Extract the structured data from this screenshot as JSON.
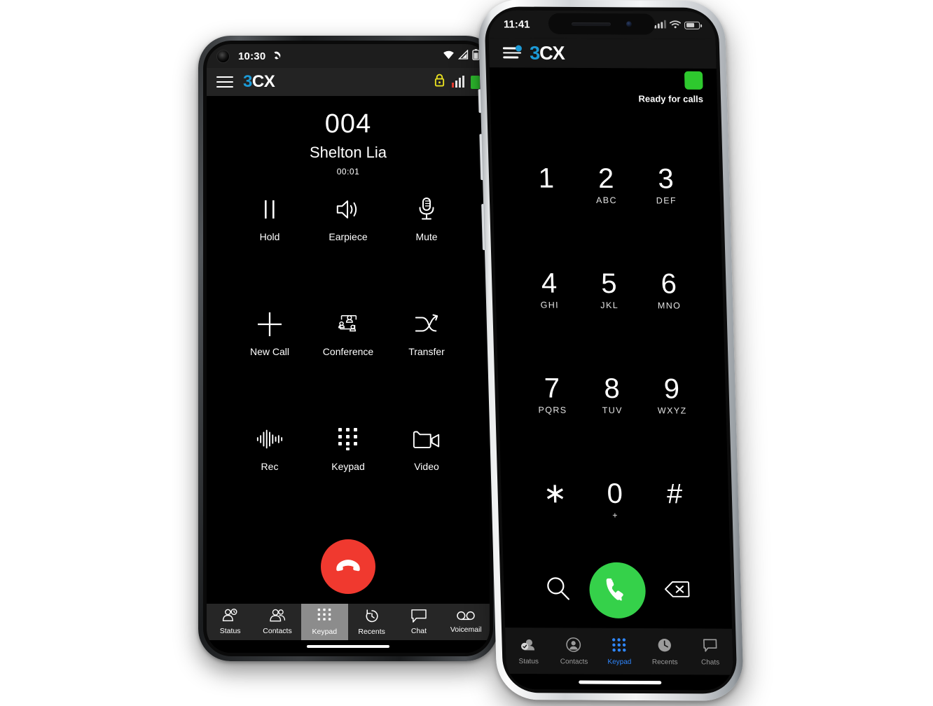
{
  "android": {
    "status_bar": {
      "time": "10:30",
      "call_icon": "phone-handset-icon",
      "wifi_icon": "wifi-icon",
      "signal_icon": "signal-triangle-icon",
      "battery_icon": "battery-icon"
    },
    "app_bar": {
      "menu_icon": "hamburger-menu-icon",
      "logo_3": "3",
      "logo_cx": "CX",
      "lock_icon": "lock-icon",
      "signal_icon": "signal-bars-icon",
      "battery_icon": "battery-full-icon"
    },
    "call": {
      "number": "004",
      "name": "Shelton Lia",
      "duration": "00:01"
    },
    "controls": [
      {
        "label": "Hold",
        "icon": "pause-icon"
      },
      {
        "label": "Earpiece",
        "icon": "speaker-icon"
      },
      {
        "label": "Mute",
        "icon": "microphone-icon"
      },
      {
        "label": "New Call",
        "icon": "plus-icon"
      },
      {
        "label": "Conference",
        "icon": "conference-people-icon"
      },
      {
        "label": "Transfer",
        "icon": "transfer-arrow-icon"
      },
      {
        "label": "Rec",
        "icon": "waveform-icon"
      },
      {
        "label": "Keypad",
        "icon": "dialpad-icon"
      },
      {
        "label": "Video",
        "icon": "video-camera-icon"
      }
    ],
    "hangup": {
      "label": "End call",
      "icon": "hangup-phone-icon",
      "color": "#f0392f"
    },
    "tabs": [
      {
        "label": "Status",
        "icon": "status-person-clock-icon",
        "active": false
      },
      {
        "label": "Contacts",
        "icon": "contacts-people-icon",
        "active": false
      },
      {
        "label": "Keypad",
        "icon": "dialpad-icon",
        "active": true
      },
      {
        "label": "Recents",
        "icon": "clock-history-icon",
        "active": false
      },
      {
        "label": "Chat",
        "icon": "chat-bubble-icon",
        "active": false
      },
      {
        "label": "Voicemail",
        "icon": "voicemail-icon",
        "active": false
      }
    ]
  },
  "iphone": {
    "status_bar": {
      "time": "11:41",
      "signal_icon": "cellular-signal-icon",
      "wifi_icon": "wifi-icon",
      "battery_icon": "battery-icon"
    },
    "app_bar": {
      "menu_icon": "hamburger-menu-icon",
      "logo_3": "3",
      "logo_cx": "CX"
    },
    "presence": {
      "text": "Ready for calls",
      "color": "#2ec92e",
      "icon": "available-status-square"
    },
    "keys": [
      {
        "digit": "1",
        "letters": ""
      },
      {
        "digit": "2",
        "letters": "ABC"
      },
      {
        "digit": "3",
        "letters": "DEF"
      },
      {
        "digit": "4",
        "letters": "GHI"
      },
      {
        "digit": "5",
        "letters": "JKL"
      },
      {
        "digit": "6",
        "letters": "MNO"
      },
      {
        "digit": "7",
        "letters": "PQRS"
      },
      {
        "digit": "8",
        "letters": "TUV"
      },
      {
        "digit": "9",
        "letters": "WXYZ"
      },
      {
        "digit": "∗",
        "letters": ""
      },
      {
        "digit": "0",
        "letters": "+"
      },
      {
        "digit": "#",
        "letters": ""
      }
    ],
    "actions": {
      "search": {
        "label": "Search",
        "icon": "magnifier-icon"
      },
      "call": {
        "label": "Call",
        "icon": "phone-handset-icon",
        "color": "#35d14a"
      },
      "backspace": {
        "label": "Backspace",
        "icon": "backspace-delete-icon"
      }
    },
    "tabs": [
      {
        "label": "Status",
        "icon": "status-person-check-icon",
        "active": false
      },
      {
        "label": "Contacts",
        "icon": "contact-circle-icon",
        "active": false
      },
      {
        "label": "Keypad",
        "icon": "dialpad-icon",
        "active": true
      },
      {
        "label": "Recents",
        "icon": "clock-icon",
        "active": false
      },
      {
        "label": "Chats",
        "icon": "chat-bubble-icon",
        "active": false
      }
    ]
  },
  "colors": {
    "brand_blue": "#1c9ad6",
    "accent_blue": "#2f87ff",
    "green": "#2ec92e",
    "call_green": "#35d14a",
    "red": "#f0392f",
    "lock_yellow": "#e8e020"
  }
}
